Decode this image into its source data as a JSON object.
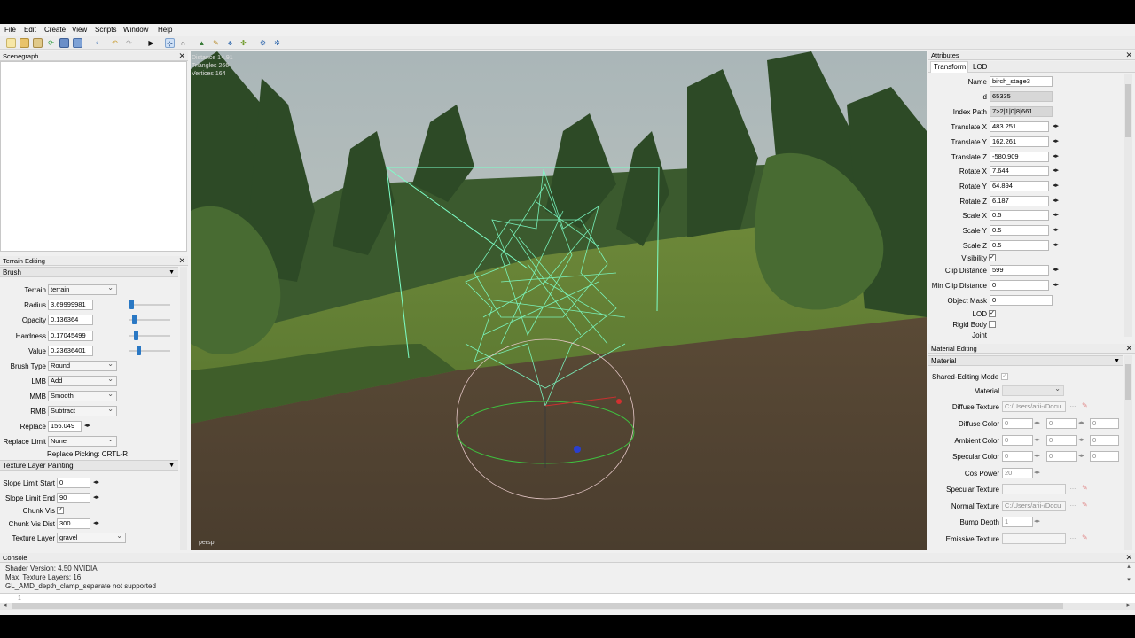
{
  "menu": [
    "File",
    "Edit",
    "Create",
    "View",
    "Scripts",
    "Window",
    "Help"
  ],
  "scenegraph": {
    "title": "Scenegraph"
  },
  "viewport": {
    "stats": [
      "Distance 14.91",
      "Triangles 266",
      "Vertices 164"
    ],
    "camera_label": "persp"
  },
  "terrain_editing": {
    "title": "Terrain Editing",
    "brush_section": "Brush",
    "terrain_label": "Terrain",
    "terrain_value": "terrain",
    "radius_label": "Radius",
    "radius_value": "3.69999981",
    "radius_level": 0.0,
    "opacity_label": "Opacity",
    "opacity_value": "0.136364",
    "hardness_label": "Hardness",
    "hardness_value": "0.17045499",
    "value_label": "Value",
    "value_value": "0.23636401",
    "brush_type_label": "Brush Type",
    "brush_type_value": "Round",
    "lmb_label": "LMB",
    "lmb_value": "Add",
    "mmb_label": "MMB",
    "mmb_value": "Smooth",
    "rmb_label": "RMB",
    "rmb_value": "Subtract",
    "replace_label": "Replace",
    "replace_value": "156.049",
    "replace_limit_label": "Replace Limit",
    "replace_limit_value": "None",
    "replace_picking": "Replace Picking: CRTL-R",
    "texture_section": "Texture Layer Painting",
    "slope_start_label": "Slope Limit Start",
    "slope_start_value": "0",
    "slope_end_label": "Slope Limit End",
    "slope_end_value": "90",
    "chunk_vis_label": "Chunk Vis",
    "chunk_vis_dist_label": "Chunk Vis Dist",
    "chunk_vis_dist_value": "300",
    "texture_layer_label": "Texture Layer",
    "texture_layer_value": "gravel"
  },
  "attributes": {
    "title": "Attributes",
    "tabs": [
      "Transform",
      "LOD"
    ],
    "name_label": "Name",
    "name_value": "birch_stage3",
    "id_label": "Id",
    "id_value": "65335",
    "index_path_label": "Index Path",
    "index_path_value": "7>2|1|0|8|661",
    "translate_x_label": "Translate X",
    "translate_x_value": "483.251",
    "translate_y_label": "Translate Y",
    "translate_y_value": "162.261",
    "translate_z_label": "Translate Z",
    "translate_z_value": "-580.909",
    "rotate_x_label": "Rotate X",
    "rotate_x_value": "7.644",
    "rotate_y_label": "Rotate Y",
    "rotate_y_value": "64.894",
    "rotate_z_label": "Rotate Z",
    "rotate_z_value": "6.187",
    "scale_x_label": "Scale X",
    "scale_x_value": "0.5",
    "scale_y_label": "Scale Y",
    "scale_y_value": "0.5",
    "scale_z_label": "Scale Z",
    "scale_z_value": "0.5",
    "visibility_label": "Visibility",
    "clip_distance_label": "Clip Distance",
    "clip_distance_value": "599",
    "min_clip_label": "Min Clip Distance",
    "min_clip_value": "0",
    "object_mask_label": "Object Mask",
    "object_mask_value": "0",
    "dots": "...",
    "lod_label": "LOD",
    "rigid_body_label": "Rigid Body",
    "joint_label": "Joint"
  },
  "material_editing": {
    "title": "Material Editing",
    "section": "Material",
    "shared_label": "Shared-Editing Mode",
    "material_label": "Material",
    "diffuse_texture_label": "Diffuse Texture",
    "diffuse_texture_value": "C:/Users/arii-/Docu",
    "diffuse_color_label": "Diffuse Color",
    "ambient_color_label": "Ambient Color",
    "specular_color_label": "Specular Color",
    "zero": "0",
    "cos_power_label": "Cos Power",
    "cos_power_value": "20",
    "specular_texture_label": "Specular Texture",
    "normal_texture_label": "Normal Texture",
    "normal_texture_value": "C:/Users/arii-/Docu",
    "bump_depth_label": "Bump Depth",
    "bump_depth_value": "1",
    "emissive_texture_label": "Emissive Texture",
    "dots": "..."
  },
  "console": {
    "title": "Console",
    "lines": [
      "Shader Version: 4.50 NVIDIA",
      "Max. Texture Layers: 16",
      "GL_AMD_depth_clamp_separate not supported"
    ],
    "input_line_number": "1"
  },
  "colors": {
    "wireframe": "#7dffc8",
    "slider": "#2a78c4",
    "panel": "#f0f0f0"
  }
}
